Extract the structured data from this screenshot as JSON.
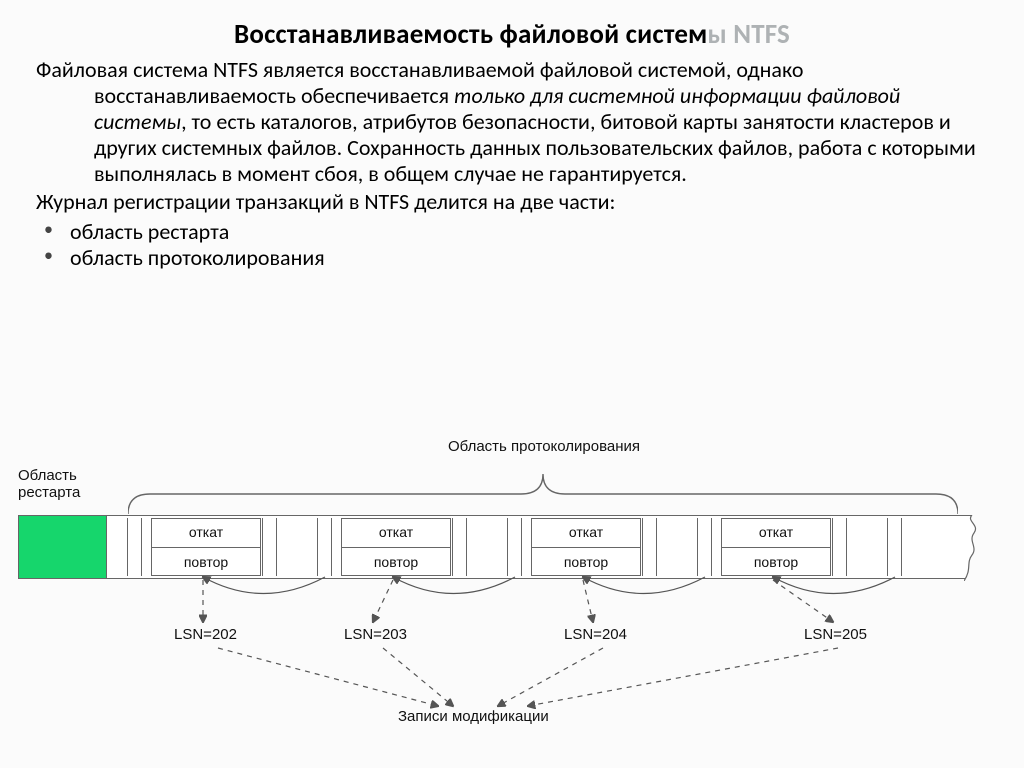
{
  "title_main": "Восстанавливаемость файловой систем",
  "title_grey": "ы NTFS",
  "para1_a": "Файловая система NTFS является восстанавливаемой файловой системой, однако восстанавливаемость обеспечивается ",
  "para1_em": "только для системной информации файловой системы",
  "para1_b": ", то есть каталогов, атрибутов безопасности, битовой карты занятости кластеров и других системных файлов. Сохранность данных пользовательских файлов, работа с которыми выполнялась в момент сбоя, в общем случае не гарантируется.",
  "para2": "Журнал регистрации транзакций в NTFS делится на две части:",
  "bullets": {
    "b0": "область рестарта",
    "b1": "область протоколирования"
  },
  "diagram": {
    "protocol_label": "Область протоколирования",
    "restart_label_l1": "Область",
    "restart_label_l2": "рестарта",
    "cell_top": "откат",
    "cell_bot": "повтор",
    "lsn": {
      "l0": "LSN=202",
      "l1": "LSN=203",
      "l2": "LSN=204",
      "l3": "LSN=205"
    },
    "mod_label": "Записи модификации"
  }
}
